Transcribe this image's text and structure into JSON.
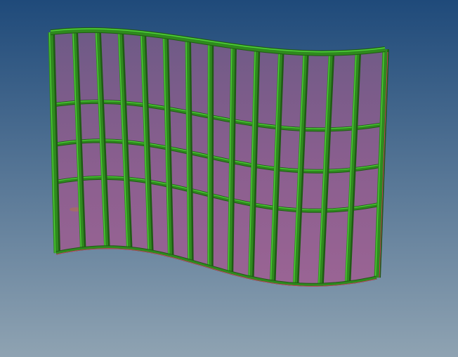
{
  "viewport": {
    "bg_top": "#1f4a7a",
    "bg_bottom": "#8fa3b2"
  },
  "model": {
    "glass_color": "#8a5a90",
    "glass_edge_color": "#b07098",
    "mullion_color": "#2f8a1e",
    "mullion_highlight": "#4fd23a",
    "mullion_shadow": "#1f5a14",
    "edge_line_color": "#e03a6a",
    "vertical_divisions": 14,
    "horizontal_divisions": 4
  }
}
